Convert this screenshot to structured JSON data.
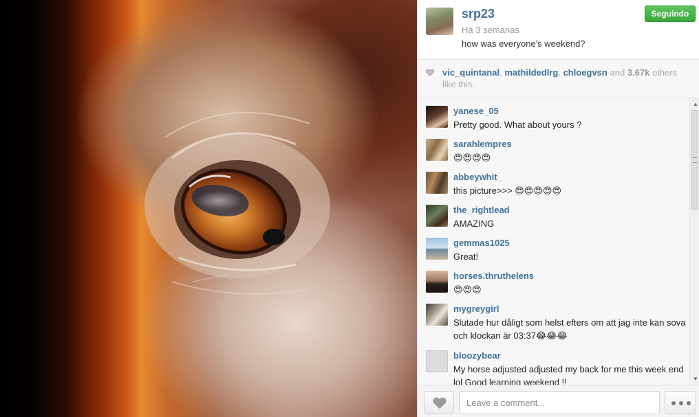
{
  "post": {
    "image_alt": "close-up of a horse eye",
    "owner": {
      "username": "srp23",
      "avatar": "horse-and-rider"
    },
    "time": "Há 3 semanas",
    "caption": "how was everyone's weekend?",
    "follow_label": "Seguindo"
  },
  "likes": {
    "icon": "heart-icon",
    "users": [
      "vic_quintanal",
      "mathildedlrg",
      "chloegvsn"
    ],
    "and_text": "and",
    "count": "3.67k",
    "suffix": "others like this."
  },
  "comments": [
    {
      "user": "yanese_05",
      "text": "Pretty good. What about yours ?",
      "avatar_color": "#5a3a2c"
    },
    {
      "user": "sarahlempres",
      "text": "😍😍😍😍",
      "avatar_color": "#b59a6d"
    },
    {
      "user": "abbeywhit_",
      "text": "this picture>>> 😍😍😍😍😍",
      "avatar_color": "#7c5b3e"
    },
    {
      "user": "the_rightlead",
      "text": "AMAZING",
      "avatar_color": "#5b6a4e"
    },
    {
      "user": "gemmas1025",
      "text": "Great!",
      "avatar_color": "#9bb8cf"
    },
    {
      "user": "horses.thruthelens",
      "text": "😍😍😍",
      "avatar_color": "#3d2f2a"
    },
    {
      "user": "mygreygirl",
      "text": "Slutade hur dåligt som helst efters om att jag inte kan sova och klockan är 03:37😂😂😂",
      "avatar_color": "#6f6658"
    },
    {
      "user": "bloozybear",
      "text": "My horse adjusted adjusted my back for me this week end lol Good learning weekend !!",
      "avatar_color": "#d6d6d6"
    }
  ],
  "comment_box": {
    "placeholder": "Leave a comment..."
  },
  "colors": {
    "link": "#3f729b",
    "follow_button": "#3aa83b",
    "panel_bg": "#f7f7f7"
  }
}
